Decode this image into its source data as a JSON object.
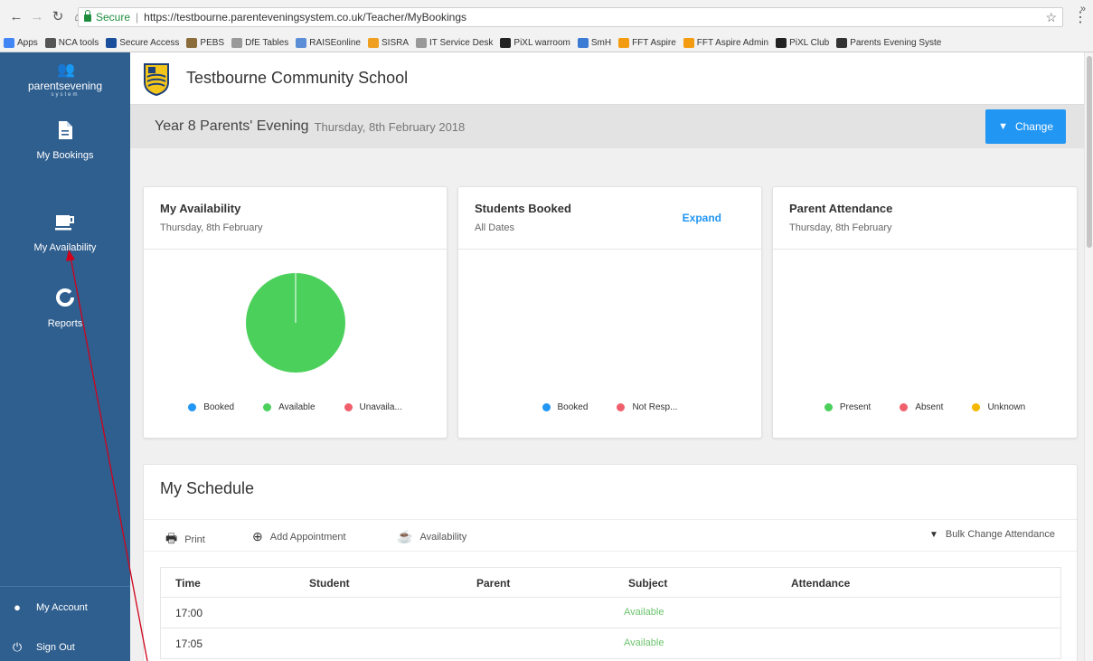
{
  "browser": {
    "secure_label": "Secure",
    "url": "https://testbourne.parenteveningsystem.co.uk/Teacher/MyBookings",
    "bookmarks": [
      {
        "label": "Apps",
        "color": "#4285f4"
      },
      {
        "label": "NCA tools",
        "color": "#555555"
      },
      {
        "label": "Secure Access",
        "color": "#1a4f9c"
      },
      {
        "label": "PEBS",
        "color": "#8a6d3b"
      },
      {
        "label": "DfE Tables",
        "color": "#999999"
      },
      {
        "label": "RAISEonline",
        "color": "#5b8ed6"
      },
      {
        "label": "SISRA",
        "color": "#f0a020"
      },
      {
        "label": "IT Service Desk",
        "color": "#999999"
      },
      {
        "label": "PiXL warroom",
        "color": "#222222"
      },
      {
        "label": "SmH",
        "color": "#3b7bd4"
      },
      {
        "label": "FFT Aspire",
        "color": "#f39c12"
      },
      {
        "label": "FFT Aspire Admin",
        "color": "#f39c12"
      },
      {
        "label": "PiXL Club",
        "color": "#222222"
      },
      {
        "label": "Parents Evening Syste",
        "color": "#333333"
      }
    ],
    "more_label": "»"
  },
  "sidebar": {
    "brand_name": "parentsevening",
    "brand_sub": "system",
    "nav": [
      {
        "label": "My Bookings",
        "icon": "document-icon"
      },
      {
        "label": "My Availability",
        "icon": "mug-icon"
      },
      {
        "label": "Reports",
        "icon": "donut-icon"
      }
    ],
    "account_label": "My Account",
    "signout_label": "Sign Out"
  },
  "header": {
    "school_name": "Testbourne Community School"
  },
  "event": {
    "title": "Year 8 Parents' Evening",
    "date": "Thursday, 8th February 2018",
    "change_label": "Change"
  },
  "cards": {
    "availability": {
      "title": "My Availability",
      "subtitle": "Thursday, 8th February",
      "legend": [
        {
          "label": "Booked",
          "color": "#2196f3"
        },
        {
          "label": "Available",
          "color": "#4cd05c"
        },
        {
          "label": "Unavaila...",
          "color": "#f0606c"
        }
      ]
    },
    "booked": {
      "title": "Students Booked",
      "subtitle": "All Dates",
      "expand_label": "Expand",
      "legend": [
        {
          "label": "Booked",
          "color": "#2196f3"
        },
        {
          "label": "Not Resp...",
          "color": "#f0606c"
        }
      ]
    },
    "attendance": {
      "title": "Parent Attendance",
      "subtitle": "Thursday, 8th February",
      "legend": [
        {
          "label": "Present",
          "color": "#4cd05c"
        },
        {
          "label": "Absent",
          "color": "#f0606c"
        },
        {
          "label": "Unknown",
          "color": "#f5b800"
        }
      ]
    }
  },
  "chart_data": {
    "type": "pie",
    "categories": [
      "Booked",
      "Available",
      "Unavaila..."
    ],
    "values": [
      0,
      100,
      0
    ],
    "colors": [
      "#2196f3",
      "#4cd05c",
      "#f0606c"
    ]
  },
  "schedule": {
    "title": "My Schedule",
    "print_label": "Print",
    "add_label": "Add Appointment",
    "availability_label": "Availability",
    "bulk_label": "Bulk Change Attendance",
    "columns": [
      "Time",
      "Student",
      "Parent",
      "Subject",
      "Attendance"
    ],
    "rows": [
      {
        "time": "17:00",
        "subject": "Available"
      },
      {
        "time": "17:05",
        "subject": "Available"
      }
    ]
  }
}
